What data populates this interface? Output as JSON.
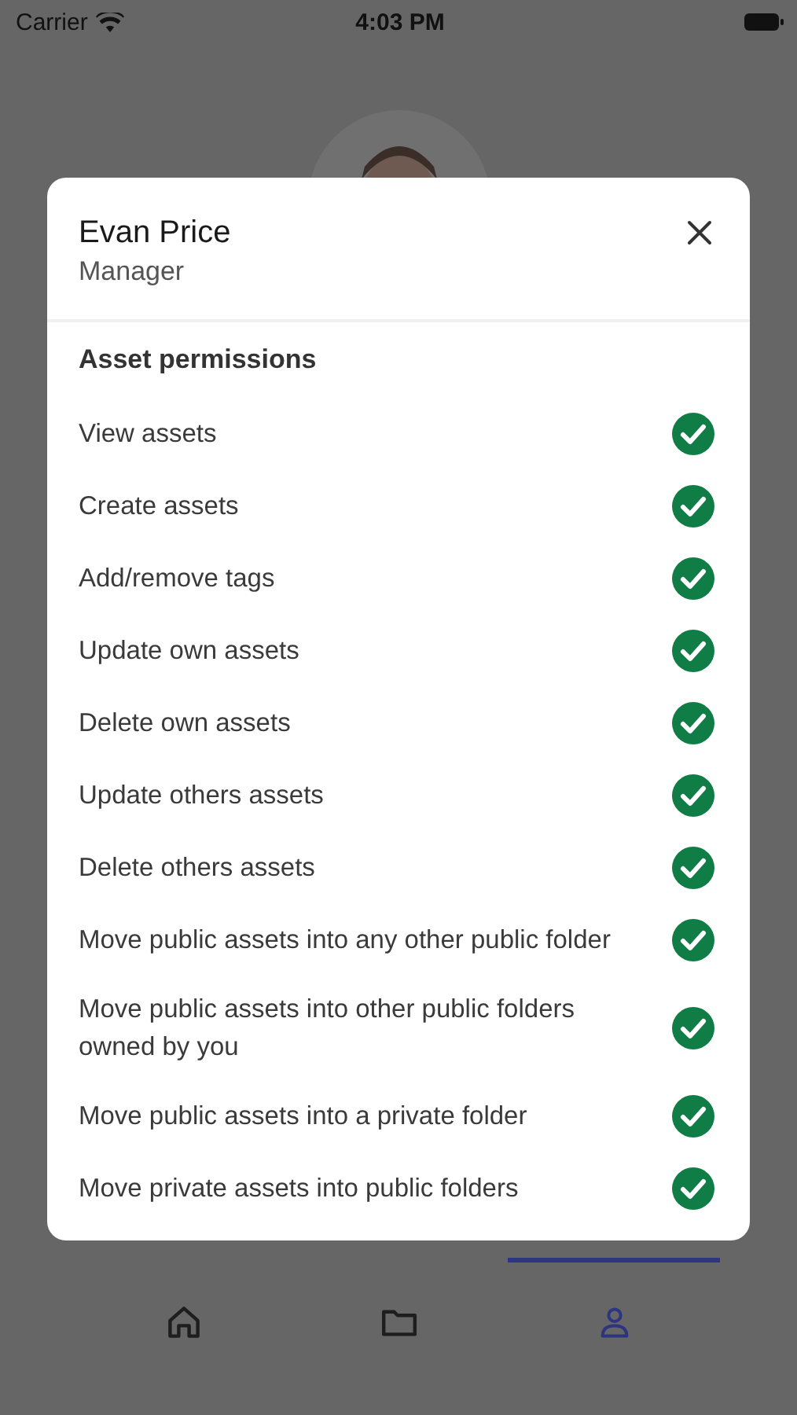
{
  "status_bar": {
    "carrier": "Carrier",
    "time": "4:03 PM"
  },
  "dialog": {
    "name": "Evan Price",
    "role": "Manager",
    "section_title": "Asset permissions",
    "permissions": [
      {
        "label": "View assets",
        "granted": true
      },
      {
        "label": "Create assets",
        "granted": true
      },
      {
        "label": "Add/remove tags",
        "granted": true
      },
      {
        "label": "Update own assets",
        "granted": true
      },
      {
        "label": "Delete own assets",
        "granted": true
      },
      {
        "label": "Update others assets",
        "granted": true
      },
      {
        "label": "Delete others assets",
        "granted": true
      },
      {
        "label": "Move public assets into any other public folder",
        "granted": true
      },
      {
        "label": "Move public assets into other public folders owned by you",
        "granted": true
      },
      {
        "label": "Move public assets into a private folder",
        "granted": true
      },
      {
        "label": "Move private assets into public folders",
        "granted": true
      }
    ]
  },
  "tab_bar": {
    "tabs": [
      {
        "kind": "home",
        "selected": false
      },
      {
        "kind": "folder",
        "selected": false
      },
      {
        "kind": "profile",
        "selected": true
      }
    ]
  }
}
